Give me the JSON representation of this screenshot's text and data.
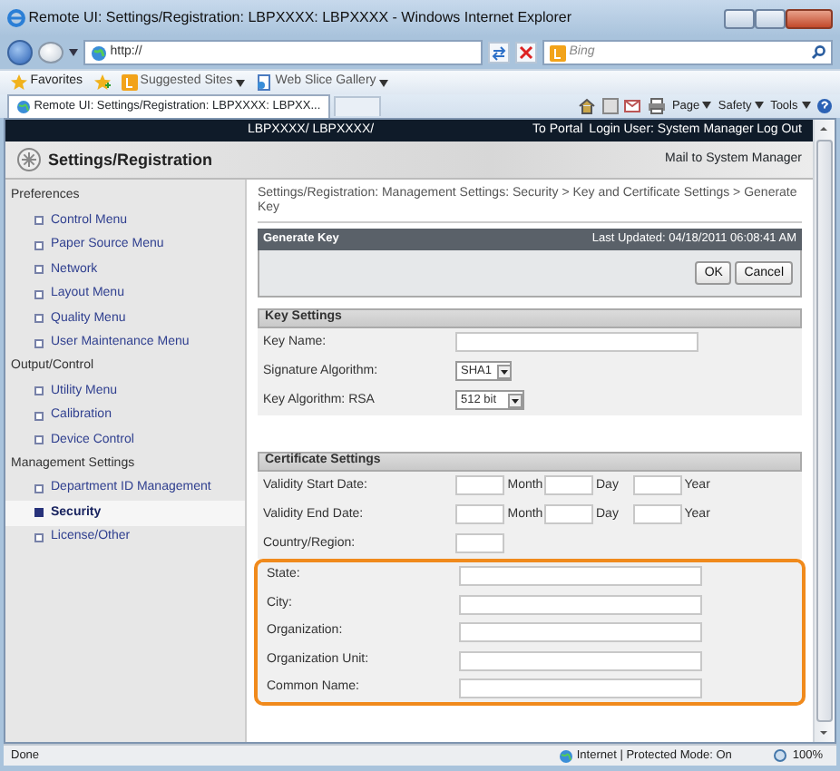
{
  "window": {
    "title": "Remote UI: Settings/Registration: LBPXXXX: LBPXXXX - Windows Internet Explorer"
  },
  "address_bar": {
    "url": "http://",
    "search_placeholder": "Bing"
  },
  "favorites_bar": {
    "label": "Favorites",
    "links": [
      "Suggested Sites",
      "Web Slice Gallery"
    ]
  },
  "tabs": [
    {
      "label": "Remote UI: Settings/Registration: LBPXXXX: LBPXX...",
      "selected": true
    }
  ],
  "command_bar": [
    "Page",
    "Safety",
    "Tools"
  ],
  "header": {
    "device": "LBPXXXX/ LBPXXXX/",
    "portal_link": "To Portal",
    "login": "Login User: System Manager",
    "logout_link": "Log Out"
  },
  "page_title": "Settings/Registration",
  "mail_link": "Mail to System Manager",
  "sidebar": [
    {
      "title": "Preferences",
      "items": [
        {
          "label": "Control Menu",
          "selected": false
        },
        {
          "label": "Paper Source Menu",
          "selected": false
        },
        {
          "label": "Network",
          "selected": false
        },
        {
          "label": "Layout Menu",
          "selected": false
        },
        {
          "label": "Quality Menu",
          "selected": false
        },
        {
          "label": "User Maintenance Menu",
          "selected": false
        }
      ]
    },
    {
      "title": "Output/Control",
      "items": [
        {
          "label": "Utility Menu",
          "selected": false
        },
        {
          "label": "Calibration",
          "selected": false
        },
        {
          "label": "Device Control",
          "selected": false
        }
      ]
    },
    {
      "title": "Management Settings",
      "items": [
        {
          "label": "Department ID Management",
          "selected": false
        },
        {
          "label": "Security",
          "selected": true
        },
        {
          "label": "License/Other",
          "selected": false
        }
      ]
    }
  ],
  "breadcrumb": "Settings/Registration: Management Settings: Security > Key and Certificate Settings > Generate Key",
  "panel": {
    "title": "Generate Key",
    "updated": "Last Updated: 04/18/2011 06:08:41 AM",
    "buttons": [
      "OK",
      "Cancel"
    ]
  },
  "key_settings": {
    "title": "Key Settings",
    "rows": [
      {
        "kind": "text",
        "label": "Key Name:"
      },
      {
        "kind": "select",
        "label": "Signature Algorithm:",
        "value": "SHA1"
      },
      {
        "kind": "select",
        "label": "Key Algorithm: RSA",
        "value": "512 bit"
      }
    ]
  },
  "certificate_settings": {
    "title": "Certificate Settings",
    "rows": [
      {
        "kind": "date",
        "label": "Validity Start Date:",
        "parts": [
          "Month",
          "Day",
          "Year"
        ]
      },
      {
        "kind": "date",
        "label": "Validity End Date:",
        "parts": [
          "Month",
          "Day",
          "Year"
        ]
      },
      {
        "kind": "short",
        "label": "Country/Region:"
      }
    ],
    "highlighted_rows": [
      {
        "kind": "text",
        "label": "State:"
      },
      {
        "kind": "text",
        "label": "City:"
      },
      {
        "kind": "text",
        "label": "Organization:"
      },
      {
        "kind": "text",
        "label": "Organization Unit:"
      },
      {
        "kind": "text",
        "label": "Common Name:"
      }
    ]
  },
  "status_bar": {
    "text": "Done",
    "zone": "Internet | Protected Mode: On",
    "zoom": "100%"
  }
}
